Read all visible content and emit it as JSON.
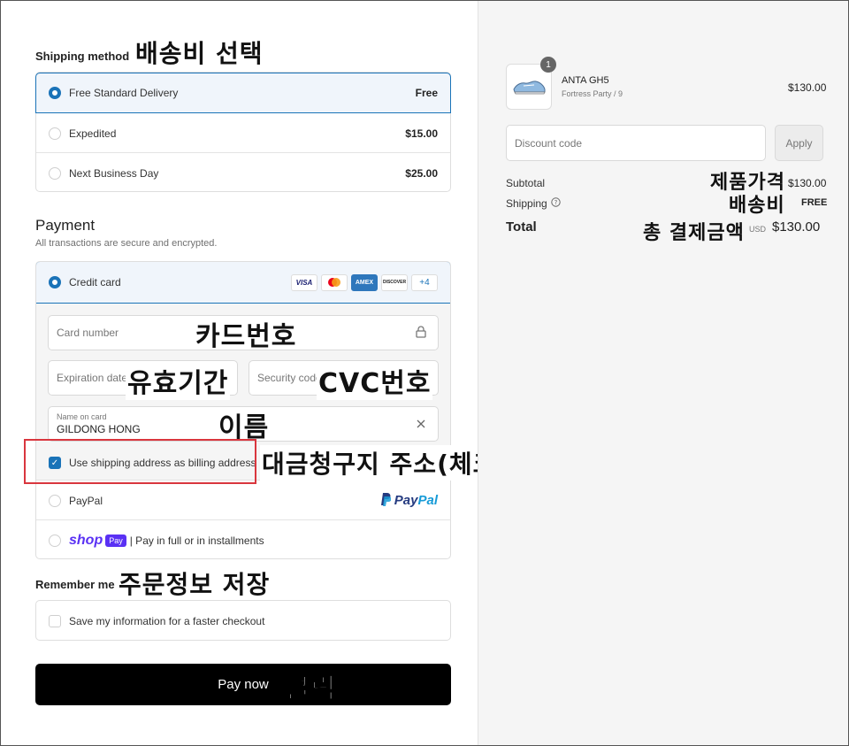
{
  "shipping": {
    "title": "Shipping method",
    "annotation": "배송비 선택",
    "options": [
      {
        "label": "Free Standard Delivery",
        "price": "Free",
        "selected": true
      },
      {
        "label": "Expedited",
        "price": "$15.00",
        "selected": false
      },
      {
        "label": "Next Business Day",
        "price": "$25.00",
        "selected": false
      }
    ]
  },
  "payment": {
    "title": "Payment",
    "subtitle": "All transactions are secure and encrypted.",
    "credit_card_label": "Credit card",
    "card_logos": [
      "VISA",
      "MC",
      "AMEX",
      "DISCOVER"
    ],
    "more_cards": "+4",
    "card_number_placeholder": "Card number",
    "card_number_annotation": "카드번호",
    "expiration_placeholder": "Expiration date",
    "expiration_annotation": "유효기간",
    "security_placeholder": "Security code",
    "security_annotation": "CVC번호",
    "name_label": "Name on card",
    "name_value": "GILDONG HONG",
    "name_annotation": "이름",
    "billing_label": "Use shipping address as billing address",
    "billing_annotation": "대금청구지 주소(체크o)",
    "paypal_label": "PayPal",
    "paypal_logo_a": "Pay",
    "paypal_logo_b": "Pal",
    "shop_logo": "shop",
    "shop_badge": "Pay",
    "shop_label": "| Pay in full or in installments"
  },
  "remember": {
    "title": "Remember me",
    "annotation": "주문정보 저장",
    "label": "Save my information for a faster checkout"
  },
  "pay_button": {
    "label": "Pay now",
    "annotation": "클릭"
  },
  "summary": {
    "quantity": "1",
    "product_name": "ANTA GH5",
    "product_variant": "Fortress Party / 9",
    "product_price": "$130.00",
    "discount_placeholder": "Discount code",
    "apply_label": "Apply",
    "subtotal_label": "Subtotal",
    "subtotal_value": "$130.00",
    "subtotal_annotation": "제품가격",
    "shipping_label": "Shipping",
    "shipping_value": "FREE",
    "shipping_annotation": "배송비",
    "total_label": "Total",
    "total_currency": "USD",
    "total_value": "$130.00",
    "total_annotation": "총 결제금액"
  },
  "colors": {
    "accent": "#1a73b8",
    "highlight_border": "#d9363e",
    "paypal_dark": "#253b80",
    "paypal_light": "#179bd7",
    "shop_purple": "#5a31f4"
  }
}
